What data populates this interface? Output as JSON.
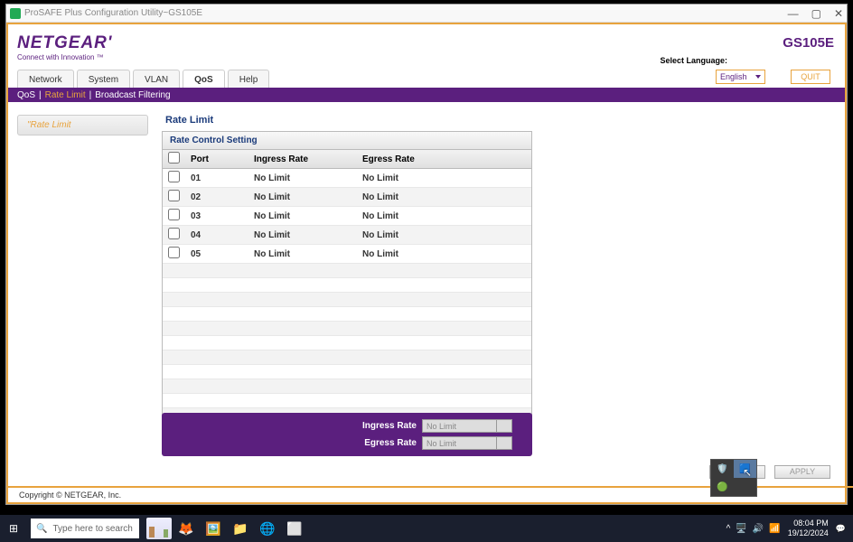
{
  "window": {
    "title": "ProSAFE Plus Configuration Utility~GS105E"
  },
  "brand": {
    "logo": "NETGEAR'",
    "tagline": "Connect with Innovation ™"
  },
  "model": "GS105E",
  "language": {
    "label": "Select Language:",
    "value": "English"
  },
  "quit_label": "QUIT",
  "main_tabs": [
    "Network",
    "System",
    "VLAN",
    "QoS",
    "Help"
  ],
  "main_tab_active": 3,
  "subnav": [
    "QoS",
    "Rate Limit",
    "Broadcast Filtering"
  ],
  "subnav_active": 1,
  "sidebar": {
    "item": "\"Rate Limit"
  },
  "panel": {
    "title": "Rate Limit",
    "section": "Rate Control Setting",
    "headers": {
      "port": "Port",
      "ingress": "Ingress Rate",
      "egress": "Egress Rate"
    },
    "rows": [
      {
        "port": "01",
        "ingress": "No Limit",
        "egress": "No Limit"
      },
      {
        "port": "02",
        "ingress": "No Limit",
        "egress": "No Limit"
      },
      {
        "port": "03",
        "ingress": "No Limit",
        "egress": "No Limit"
      },
      {
        "port": "04",
        "ingress": "No Limit",
        "egress": "No Limit"
      },
      {
        "port": "05",
        "ingress": "No Limit",
        "egress": "No Limit"
      }
    ]
  },
  "footer_controls": {
    "ingress_label": "Ingress Rate",
    "egress_label": "Egress Rate",
    "placeholder": "No Limit"
  },
  "actions": {
    "cancel": "CANCEL",
    "apply": "APPLY"
  },
  "copyright": "Copyright © NETGEAR, Inc.",
  "taskbar": {
    "search_placeholder": "Type here to search",
    "time": "08:04 PM",
    "date": "19/12/2024"
  }
}
